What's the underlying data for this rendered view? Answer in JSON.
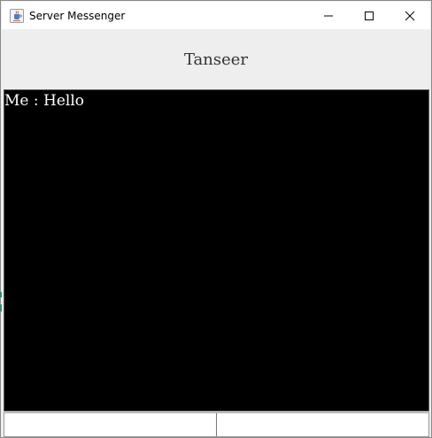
{
  "window": {
    "title": "Server Messenger",
    "icons": {
      "app": "java-cup-icon",
      "minimize": "minimize-icon",
      "maximize": "maximize-icon",
      "close": "close-icon"
    }
  },
  "header": {
    "name": "Tanseer"
  },
  "chat": {
    "messages": [
      {
        "text": "Me : Hello"
      }
    ]
  },
  "input": {
    "value": "",
    "placeholder": ""
  },
  "colors": {
    "chat_bg": "#000000",
    "chat_text": "#ffffff",
    "header_bg": "#eeeeee"
  }
}
